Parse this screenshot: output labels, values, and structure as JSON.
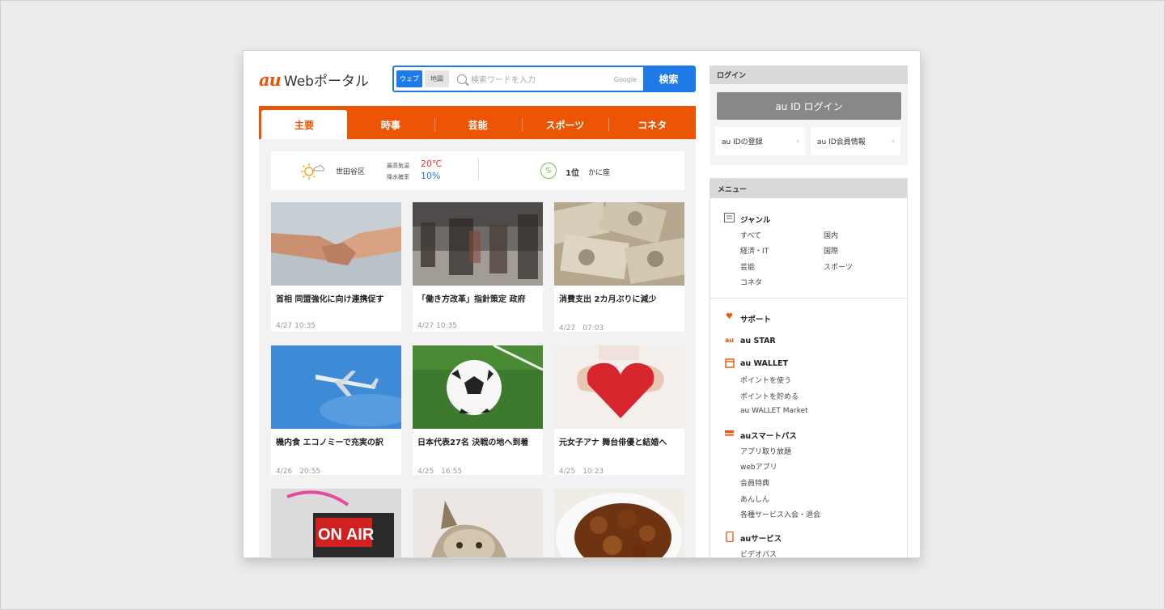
{
  "logo": {
    "brand": "au",
    "text": "Webポータル"
  },
  "search": {
    "tab_web": "ウェブ",
    "tab_map": "地図",
    "placeholder": "検索ワードを入力",
    "provider": "Google",
    "button": "検索"
  },
  "nav": {
    "tabs": [
      "主要",
      "時事",
      "芸能",
      "スポーツ",
      "コネタ"
    ],
    "active": "主要"
  },
  "weather": {
    "location": "世田谷区",
    "temp_label": "最高気温",
    "rain_label": "降水確率",
    "temp": "20℃",
    "rain": "10%"
  },
  "horoscope": {
    "rank": "1位",
    "sign": "かに座"
  },
  "articles": [
    {
      "title": "首相 同盟強化に向け連携促す",
      "date": "4/27 10:35",
      "image": "handshake"
    },
    {
      "title": "「働き方改革」指針策定 政府",
      "date": "4/27 10:35",
      "image": "commuters"
    },
    {
      "title": "消費支出 2カ月ぶりに減少",
      "date": "4/27　07:03",
      "image": "yen-notes"
    },
    {
      "title": "機内食 エコノミーで充実の訳",
      "date": "4/26　20:55",
      "image": "airplane"
    },
    {
      "title": "日本代表27名 決戦の地へ到着",
      "date": "4/25　16:55",
      "image": "soccer-ball"
    },
    {
      "title": "元女子アナ 舞台俳優と結婚へ",
      "date": "4/25　10:23",
      "image": "heart"
    },
    {
      "image": "on-air-sign"
    },
    {
      "image": "cat"
    },
    {
      "image": "curry"
    }
  ],
  "login": {
    "header": "ログイン",
    "button": "au ID ログイン",
    "register": "au IDの登録",
    "member_info": "au ID会員情報"
  },
  "menu": {
    "header": "メニュー",
    "genre": {
      "title": "ジャンル",
      "items": [
        "すべて",
        "国内",
        "経済・IT",
        "国際",
        "芸能",
        "スポーツ",
        "コネタ"
      ]
    },
    "support": "サポート",
    "au_star": "au STAR",
    "au_wallet": {
      "title": "au WALLET",
      "items": [
        "ポイントを使う",
        "ポイントを貯める",
        "au WALLET Market"
      ]
    },
    "smartpass": {
      "title": "auスマートパス",
      "items": [
        "アプリ取り放題",
        "webアプリ",
        "会員特典",
        "あんしん",
        "各種サービス入会・退会"
      ]
    },
    "services": {
      "title": "auサービス",
      "items": [
        "ビデオパス"
      ]
    }
  },
  "colors": {
    "brand_orange": "#eb5505",
    "accent_blue": "#1f7ae8",
    "temp_red": "#ee3333",
    "background": "#ececec"
  }
}
